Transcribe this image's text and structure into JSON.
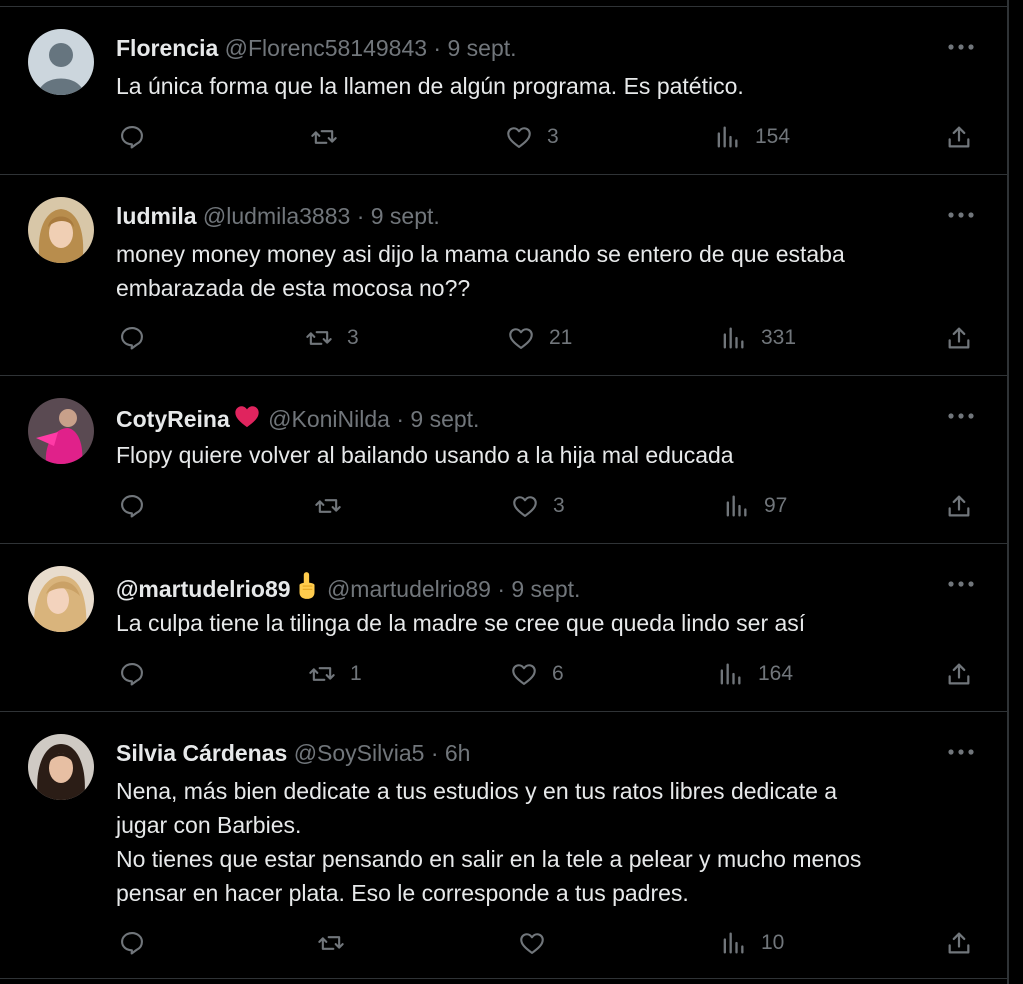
{
  "tweets": [
    {
      "name": "Florencia",
      "handle": "@Florenc58149843",
      "sep": "·",
      "time": "9 sept.",
      "lines": [
        "La única forma que la llamen de algún programa. Es patético."
      ],
      "avatar": "default-avatar",
      "replies": "",
      "retweets": "",
      "likes": "3",
      "views": "154"
    },
    {
      "name": "ludmila",
      "handle": "@ludmila3883",
      "sep": "·",
      "time": "9 sept.",
      "lines": [
        "money money money asi dijo la mama cuando se entero de que estaba",
        "embarazada de esta mocosa no??"
      ],
      "avatar": "blonde-woman-photo",
      "replies": "",
      "retweets": "3",
      "likes": "21",
      "views": "331"
    },
    {
      "name": "CotyReina",
      "name_emoji": "red-heart",
      "handle": "@KoniNilda",
      "sep": "·",
      "time": "9 sept.",
      "lines": [
        "Flopy quiere volver al bailando usando a la hija mal educada"
      ],
      "avatar": "pink-outfit-photo",
      "replies": "",
      "retweets": "",
      "likes": "3",
      "views": "97"
    },
    {
      "name": "@martudelrio89",
      "name_emoji": "pointing-up-hand",
      "handle": "@martudelrio89",
      "sep": "·",
      "time": "9 sept.",
      "lines": [
        "La culpa tiene la tilinga de la madre se cree que queda lindo ser así"
      ],
      "avatar": "blonde-hair-photo",
      "replies": "",
      "retweets": "1",
      "likes": "6",
      "views": "164"
    },
    {
      "name": "Silvia Cárdenas",
      "handle": "@SoySilvia5",
      "sep": "·",
      "time": "6h",
      "lines": [
        "Nena, más bien dedicate a tus estudios y en tus ratos libres  dedicate a",
        "jugar con Barbies.",
        "No tienes que estar pensando en salir en la tele a pelear y mucho menos",
        "pensar en hacer plata. Eso le corresponde a tus padres."
      ],
      "avatar": "dark-hair-woman-photo",
      "replies": "",
      "retweets": "",
      "likes": "",
      "views": "10"
    }
  ],
  "colors": {
    "background": "#000000",
    "text": "#e7e9ea",
    "secondary": "#71767b",
    "border": "#2f3336",
    "heart_emoji": "#e0245e"
  }
}
